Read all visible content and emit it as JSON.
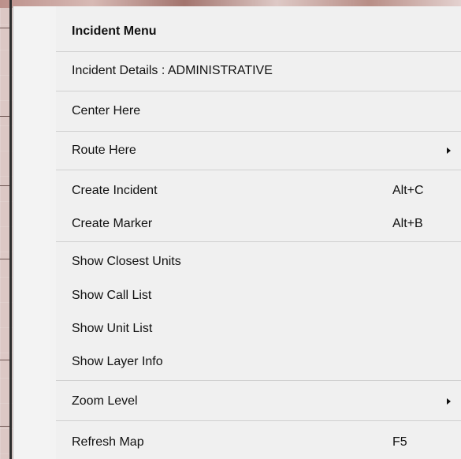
{
  "menu": {
    "title": "Incident Menu",
    "items": [
      {
        "label": "Incident Details : ADMINISTRATIVE"
      },
      {
        "label": "Center Here"
      },
      {
        "label": "Route Here"
      },
      {
        "label": "Create Incident",
        "shortcut": "Alt+C"
      },
      {
        "label": "Create Marker",
        "shortcut": "Alt+B"
      },
      {
        "label": "Show Closest Units"
      },
      {
        "label": "Show Call List"
      },
      {
        "label": "Show Unit List"
      },
      {
        "label": "Show Layer Info"
      },
      {
        "label": "Zoom Level"
      },
      {
        "label": "Refresh Map",
        "shortcut": "F5"
      }
    ]
  },
  "icons": {
    "submenu": "chevron-right-icon"
  },
  "colors": {
    "menu_background": "#f0f0f0",
    "separator": "#d0d0d0",
    "text": "#111111",
    "map_background": "#dcc8c5"
  }
}
